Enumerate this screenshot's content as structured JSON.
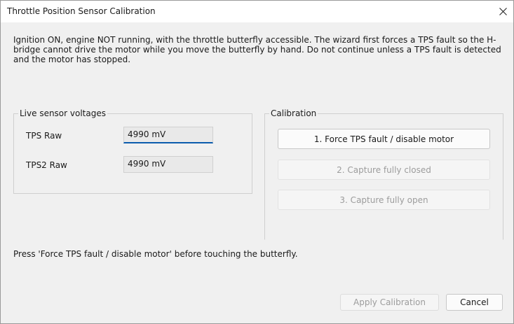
{
  "window": {
    "title": "Throttle Position Sensor Calibration"
  },
  "instructions": "Ignition ON, engine NOT running, with the throttle butterfly accessible. The wizard first forces a TPS fault so the H-bridge cannot drive the motor while you move the butterfly by hand. Do not continue unless a TPS fault is detected and the motor has stopped.",
  "live": {
    "legend": "Live sensor voltages",
    "rows": [
      {
        "label": "TPS Raw",
        "value": "4990 mV"
      },
      {
        "label": "TPS2 Raw",
        "value": "4990 mV"
      }
    ]
  },
  "calibration": {
    "legend": "Calibration",
    "buttons": [
      {
        "label": "1. Force TPS fault / disable motor",
        "enabled": true
      },
      {
        "label": "2. Capture fully closed",
        "enabled": false
      },
      {
        "label": "3. Capture fully open",
        "enabled": false
      }
    ]
  },
  "status": "Press 'Force TPS fault / disable motor' before touching the butterfly.",
  "footer": {
    "apply_label": "Apply Calibration",
    "cancel_label": "Cancel"
  }
}
